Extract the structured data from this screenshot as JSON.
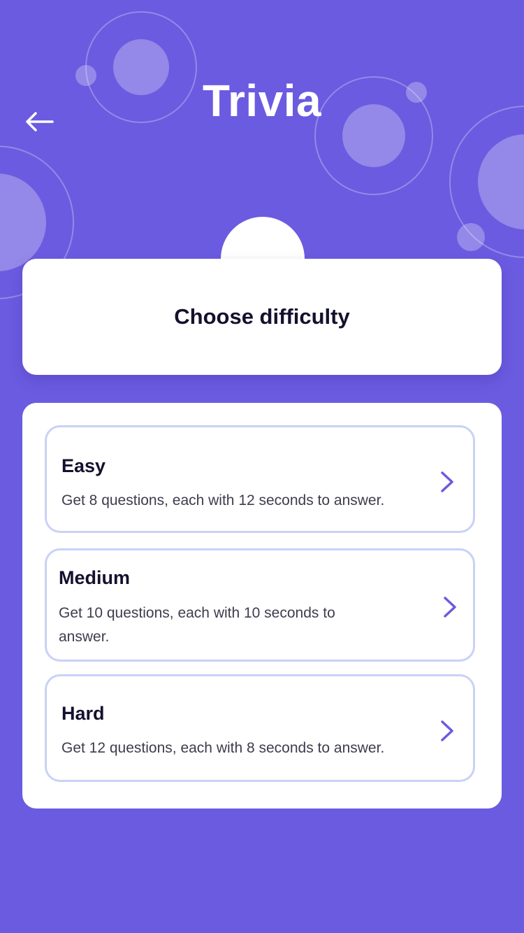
{
  "app": {
    "title": "Trivia"
  },
  "header": {
    "back_icon": "arrow-left-icon",
    "card_title": "Choose difficulty"
  },
  "difficulties": [
    {
      "title": "Easy",
      "description": "Get 8 questions, each with 12 seconds to answer.",
      "icon": "chevron-right-icon"
    },
    {
      "title": "Medium",
      "description": "Get 10 questions, each with 10 seconds to answer.",
      "icon": "chevron-right-icon"
    },
    {
      "title": "Hard",
      "description": "Get 12 questions, each with 8 seconds to answer.",
      "icon": "chevron-right-icon"
    }
  ],
  "colors": {
    "background": "#6B5BE0",
    "card": "#FFFFFF",
    "card_border": "#C9D2F5",
    "accent": "#6B5BE0",
    "text_dark": "#14112E",
    "text_body": "#3D3D4E"
  }
}
